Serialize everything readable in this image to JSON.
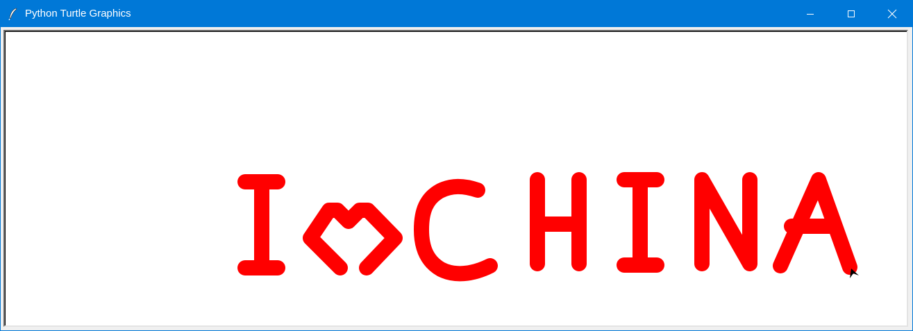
{
  "window": {
    "title": "Python Turtle Graphics",
    "titlebar_color": "#0078d7",
    "app_icon": "feather-icon"
  },
  "controls": {
    "minimize_icon": "minimize-icon",
    "maximize_icon": "maximize-icon",
    "close_icon": "close-icon"
  },
  "canvas": {
    "background": "#ffffff",
    "drawing_text": "I ♥ CHINA",
    "pen_color": "#ff0000",
    "cursor_icon": "turtle-arrow-icon",
    "cursor_color": "#000000"
  }
}
